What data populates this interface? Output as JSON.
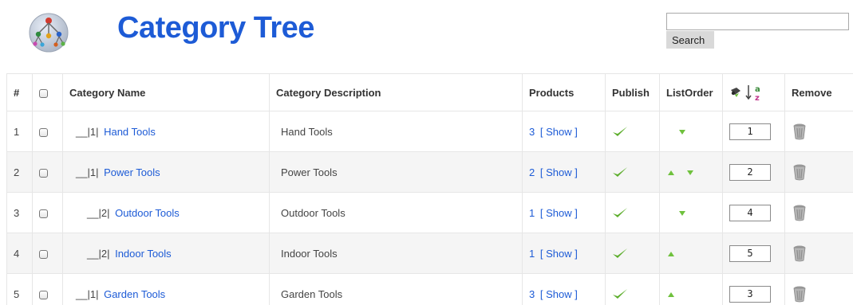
{
  "header": {
    "title": "Category Tree",
    "search_placeholder": "",
    "search_button": "Search"
  },
  "table": {
    "columns": {
      "num": "#",
      "name": "Category Name",
      "description": "Category Description",
      "products": "Products",
      "publish": "Publish",
      "listorder": "ListOrder",
      "remove": "Remove"
    },
    "rows": [
      {
        "num": "1",
        "prefix": "__|1|",
        "name": "Hand Tools",
        "description": "Hand Tools",
        "product_count": "3",
        "show_label": "[ Show ]",
        "order": "1"
      },
      {
        "num": "2",
        "prefix": "__|1|",
        "name": "Power Tools",
        "description": "Power Tools",
        "product_count": "2",
        "show_label": "[ Show ]",
        "order": "2"
      },
      {
        "num": "3",
        "prefix": "__|2|",
        "name": "Outdoor Tools",
        "description": "Outdoor Tools",
        "product_count": "1",
        "show_label": "[ Show ]",
        "order": "4"
      },
      {
        "num": "4",
        "prefix": "__|2|",
        "name": "Indoor Tools",
        "description": "Indoor Tools",
        "product_count": "1",
        "show_label": "[ Show ]",
        "order": "5"
      },
      {
        "num": "5",
        "prefix": "__|1|",
        "name": "Garden Tools",
        "description": "Garden Tools",
        "product_count": "3",
        "show_label": "[ Show ]",
        "order": "3"
      }
    ]
  },
  "colors": {
    "title": "#1d5bd6",
    "link": "#1d5bd6",
    "check": "#5cad2b",
    "arrow": "#6fc13d"
  },
  "icons": {
    "logo": "category-tree-logo",
    "publish": "checkmark-icon",
    "move_up": "arrow-up-icon",
    "move_down": "arrow-down-icon",
    "save_order": "save-order-icon",
    "sort_alpha": "sort-alpha-icon",
    "remove": "trash-icon"
  }
}
